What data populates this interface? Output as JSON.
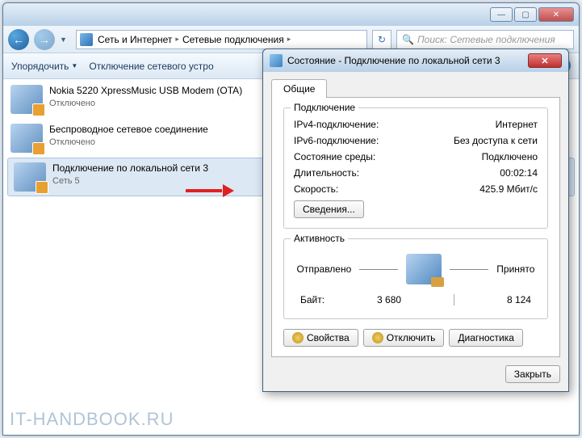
{
  "titlebar": {
    "minimize": "—",
    "maximize": "▢",
    "close": "✕"
  },
  "nav": {
    "back": "←",
    "forward": "→",
    "dropdown": "▼",
    "refresh": "↻"
  },
  "breadcrumb": {
    "items": [
      "Сеть и Интернет",
      "Сетевые подключения"
    ],
    "sep": "▸"
  },
  "search": {
    "placeholder": "Поиск: Сетевые подключения",
    "icon": "🔍"
  },
  "toolbar": {
    "organize": "Упорядочить",
    "disable": "Отключение сетевого устро",
    "dd": "▼",
    "help": "?"
  },
  "connections": [
    {
      "name": "Nokia 5220 XpressMusic USB Modem (OTA)",
      "status": "Отключено"
    },
    {
      "name": "Беспроводное сетевое соединение",
      "status": "Отключено"
    },
    {
      "name": "Подключение по локальной сети 3",
      "status": "Сеть 5"
    }
  ],
  "dialog": {
    "title": "Состояние - Подключение по локальной сети 3",
    "close": "✕",
    "tab": "Общие",
    "group_conn": "Подключение",
    "rows": [
      {
        "lbl": "IPv4-подключение:",
        "val": "Интернет"
      },
      {
        "lbl": "IPv6-подключение:",
        "val": "Без доступа к сети"
      },
      {
        "lbl": "Состояние среды:",
        "val": "Подключено"
      },
      {
        "lbl": "Длительность:",
        "val": "00:02:14"
      },
      {
        "lbl": "Скорость:",
        "val": "425.9 Мбит/с"
      }
    ],
    "details_btn": "Сведения...",
    "group_act": "Активность",
    "sent": "Отправлено",
    "received": "Принято",
    "bytes_lbl": "Байт:",
    "bytes_sent": "3 680",
    "bytes_recv": "8 124",
    "props_btn": "Свойства",
    "disable_btn": "Отключить",
    "diag_btn": "Диагностика",
    "close_btn": "Закрыть"
  },
  "watermark": "IT-HANDBOOK.RU"
}
